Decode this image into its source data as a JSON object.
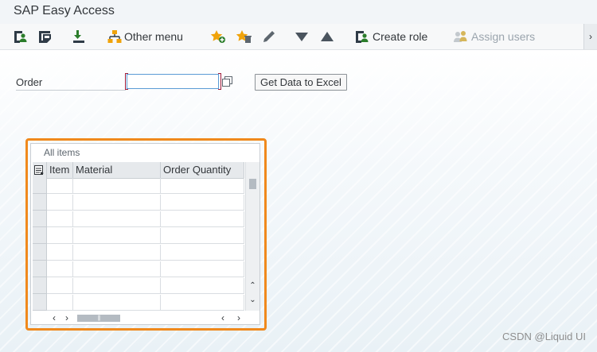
{
  "window": {
    "title": "SAP Easy Access"
  },
  "toolbar": {
    "favorites_label": "Other menu",
    "create_role_label": "Create role",
    "assign_users_label": "Assign users",
    "icons": [
      "user-menu-icon",
      "sap-menu-icon",
      "download-icon",
      "other-menu-icon",
      "add-favorite-icon",
      "delete-favorite-icon",
      "edit-icon",
      "move-down-icon",
      "move-up-icon",
      "create-role-icon",
      "assign-users-icon",
      "more-icon"
    ],
    "more_glyph": "›"
  },
  "form": {
    "order_label": "Order",
    "order_value": "",
    "excel_button": "Get Data to Excel"
  },
  "table": {
    "title": "All items",
    "columns": [
      "Item",
      "Material",
      "Order Quantity"
    ],
    "visible_rows": 8,
    "scroll_up": "⌃",
    "scroll_down": "⌄",
    "scroll_left": "‹",
    "scroll_right": "›",
    "thumb_grip": "|||"
  },
  "colors": {
    "highlight": "#f0891c",
    "input_border": "#5b9bd5",
    "required_bracket": "#a01c3a",
    "sap_green": "#2b7d2b"
  },
  "watermark": "CSDN @Liquid UI"
}
